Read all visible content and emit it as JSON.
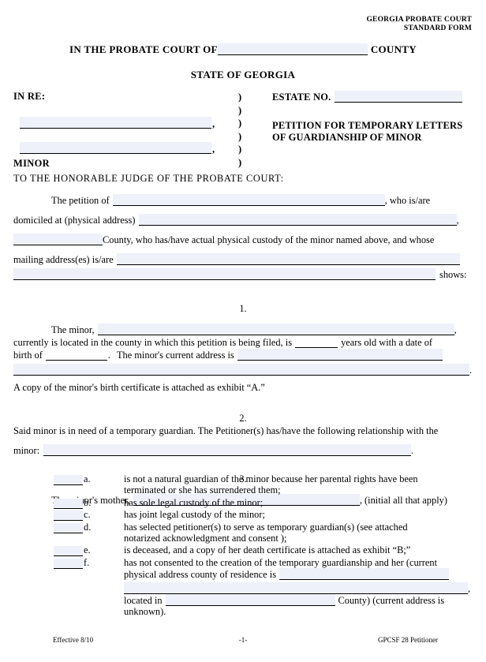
{
  "header": {
    "agency_line1": "GEORGIA PROBATE COURT",
    "agency_line2": "STANDARD FORM",
    "court_prefix": "IN THE PROBATE COURT OF",
    "court_suffix": "COUNTY",
    "state_line": "STATE OF GEORGIA"
  },
  "caption": {
    "in_re_label": "IN RE:",
    "minor_label": "MINOR",
    "paren": ")",
    "estate_no_label": "ESTATE NO.",
    "petition_title_line1": "PETITION  FOR  TEMPORARY LETTERS",
    "petition_title_line2": "OF  GUARDIANSHIP OF MINOR"
  },
  "body": {
    "honorable": "TO  THE  HONORABLE  JUDGE  OF  THE  PROBATE  COURT:",
    "petition_of": "The petition of",
    "who_is_are": ", who is/are",
    "domiciled_at": "domiciled at (physical address)",
    "domiciled_comma": ",",
    "county_custody": "County, who has/have actual physical custody of the minor named above, and whose",
    "mailing_address": "mailing address(es) is/are",
    "shows": "shows:"
  },
  "section1": {
    "number": "1.",
    "minor_lead": "The minor,",
    "minor_comma": ",",
    "located_text": "currently is located in the county in which this petition is being filed, is",
    "years_old": "years old with a date of",
    "birth_of": "birth of",
    "period": ".",
    "current_address": "The minor's current address is",
    "end_period": ".",
    "birth_cert": "A copy of the minor's birth certificate is attached as exhibit “A.”"
  },
  "section2": {
    "number": "2.",
    "text": "Said minor is in need of a temporary guardian.  The Petitioner(s) has/have the following relationship with the",
    "minor_label": "minor:",
    "end_period": "."
  },
  "section3": {
    "number": "3.",
    "mother_lead": "The minor's mother,",
    "initial_note": ", (initial all that apply)",
    "items": [
      {
        "letter": "a.",
        "lines": [
          "is not a natural guardian of the minor because her parental rights have been",
          "terminated or she has surrendered them;"
        ]
      },
      {
        "letter": "b.",
        "lines": [
          "has sole legal custody of the minor;"
        ]
      },
      {
        "letter": "c.",
        "lines": [
          "has joint legal custody of the minor;"
        ]
      },
      {
        "letter": "d.",
        "lines": [
          "has selected petitioner(s) to serve as temporary guardian(s) (see attached",
          "notarized acknowledgment and consent );"
        ]
      },
      {
        "letter": "e.",
        "lines": [
          "is deceased, and a copy of her death certificate is attached as exhibit “B;”"
        ]
      },
      {
        "letter": "f.",
        "lines": [
          "has not consented to the creation of the temporary guardianship and her (current",
          "physical address county of residence is"
        ],
        "continuation_comma": ",",
        "located_in": "located in",
        "county_paren": "County) (current address is",
        "unknown": "unknown)."
      }
    ]
  },
  "footer": {
    "effective": "Effective 8/10",
    "page": "-1-",
    "form_id": "GPCSF 28 Petitioner"
  },
  "colors": {
    "field_fill": "#eef0fa",
    "text": "#000000",
    "page": "#ffffff"
  }
}
